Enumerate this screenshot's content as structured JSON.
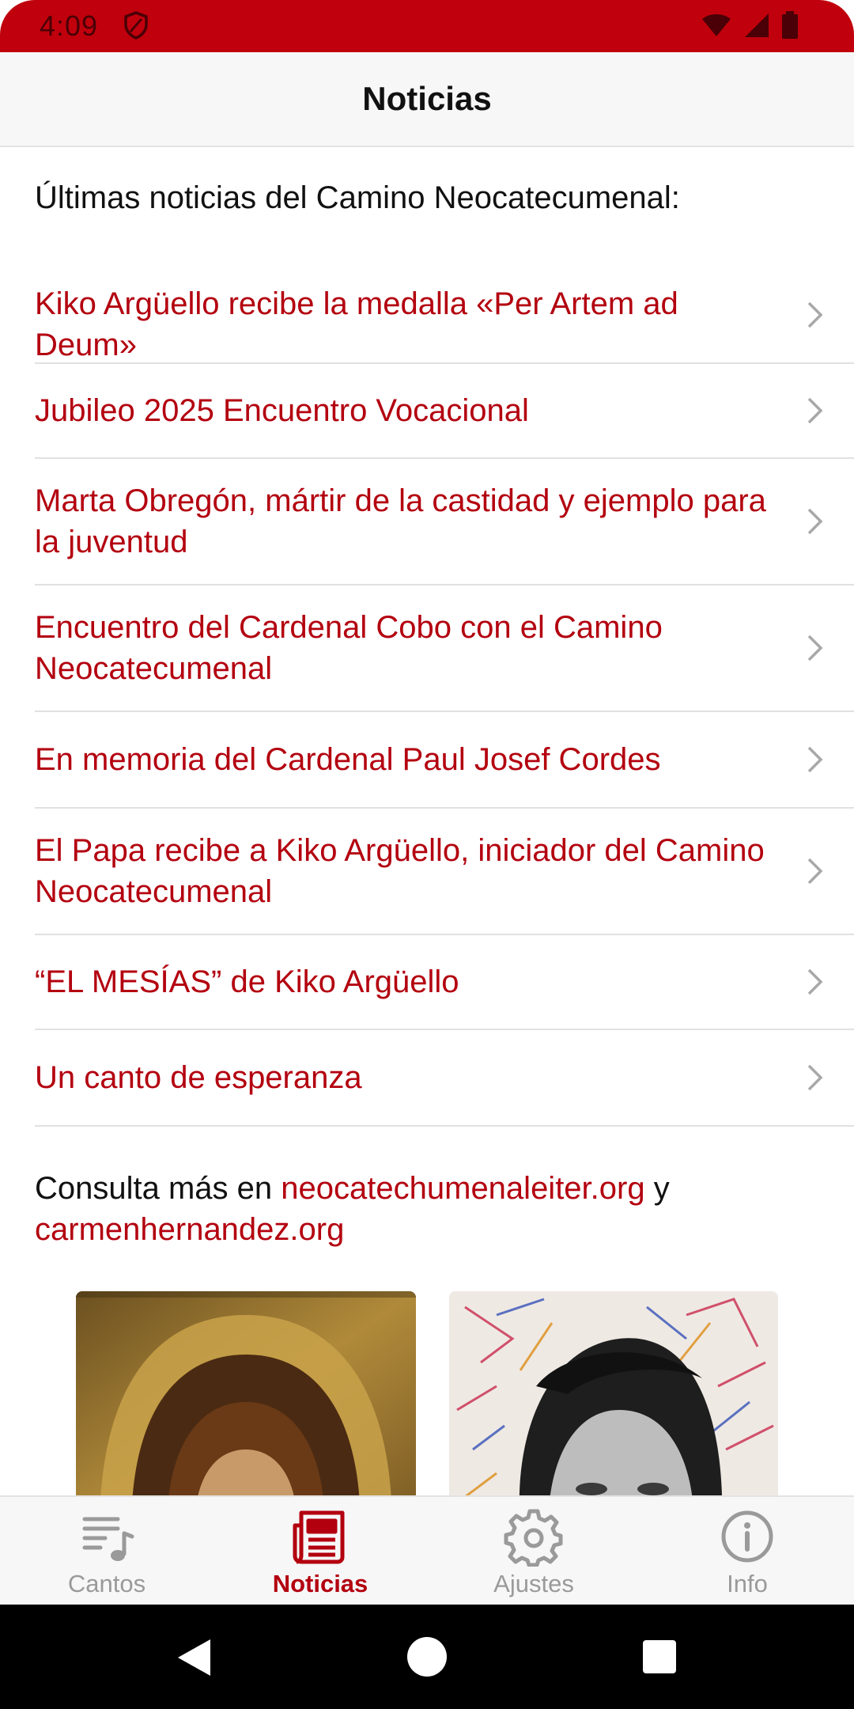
{
  "status_bar": {
    "time": "4:09",
    "background": "#c0000c"
  },
  "app_bar": {
    "title": "Noticias"
  },
  "intro": "Últimas noticias del Camino Neocatecumenal:",
  "news": [
    {
      "title": "Kiko Argüello recibe la medalla «Per Artem ad Deum»"
    },
    {
      "title": "Jubileo 2025 Encuentro Vocacional"
    },
    {
      "title": "Marta Obregón, mártir de la castidad y ejemplo para la juventud"
    },
    {
      "title": "Encuentro del Cardenal Cobo con el Camino Neocatecumenal"
    },
    {
      "title": "En memoria del Cardenal Paul Josef Cordes"
    },
    {
      "title": "El Papa recibe a Kiko Argüello, iniciador del Camino Neocatecumenal"
    },
    {
      "title": "“EL MESÍAS” de Kiko Argüello"
    },
    {
      "title": "Un canto de esperanza"
    }
  ],
  "more": {
    "prefix": "Consulta más en ",
    "link1": "neocatechumenaleiter.org",
    "middle": " y ",
    "link2": "carmenhernandez.org"
  },
  "bottom_nav": [
    {
      "label": "Cantos",
      "icon": "music-list-icon",
      "active": false
    },
    {
      "label": "Noticias",
      "icon": "newspaper-icon",
      "active": true
    },
    {
      "label": "Ajustes",
      "icon": "gear-icon",
      "active": false
    },
    {
      "label": "Info",
      "icon": "info-icon",
      "active": false
    }
  ],
  "colors": {
    "accent": "#b3000f",
    "inactive": "#9a9a9a"
  }
}
